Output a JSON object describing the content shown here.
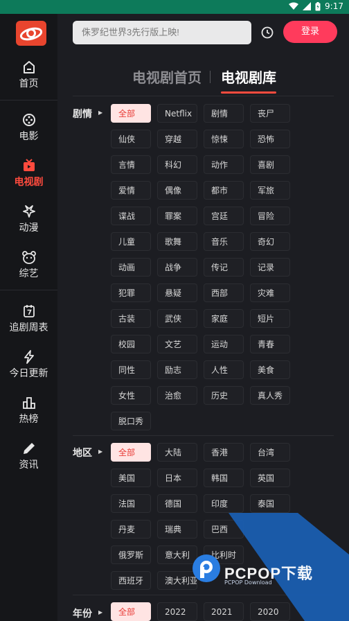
{
  "status_bar": {
    "time": "9:17"
  },
  "sidebar": {
    "items": [
      {
        "label": "首页",
        "icon": "home-icon"
      },
      {
        "label": "电影",
        "icon": "film-reel-icon"
      },
      {
        "label": "电视剧",
        "icon": "tv-icon",
        "active": true
      },
      {
        "label": "动漫",
        "icon": "star-outline-icon"
      },
      {
        "label": "综艺",
        "icon": "bear-face-icon"
      },
      {
        "label": "追剧周表",
        "icon": "calendar-7-icon"
      },
      {
        "label": "今日更新",
        "icon": "lightning-icon"
      },
      {
        "label": "热榜",
        "icon": "bar-chart-icon"
      },
      {
        "label": "资讯",
        "icon": "pencil-icon"
      }
    ]
  },
  "header": {
    "search_placeholder": "侏罗纪世界3先行版上映!",
    "login_label": "登录"
  },
  "tabs": [
    {
      "label": "电视剧首页",
      "active": false
    },
    {
      "label": "电视剧库",
      "active": true
    }
  ],
  "filters": {
    "genre": {
      "label": "剧情",
      "options": [
        "全部",
        "Netflix",
        "剧情",
        "丧尸",
        "仙侠",
        "穿越",
        "惊悚",
        "恐怖",
        "言情",
        "科幻",
        "动作",
        "喜剧",
        "爱情",
        "偶像",
        "都市",
        "军旅",
        "谍战",
        "罪案",
        "宫廷",
        "冒险",
        "儿童",
        "歌舞",
        "音乐",
        "奇幻",
        "动画",
        "战争",
        "传记",
        "记录",
        "犯罪",
        "悬疑",
        "西部",
        "灾难",
        "古装",
        "武侠",
        "家庭",
        "短片",
        "校园",
        "文艺",
        "运动",
        "青春",
        "同性",
        "励志",
        "人性",
        "美食",
        "女性",
        "治愈",
        "历史",
        "真人秀",
        "脱口秀"
      ]
    },
    "region": {
      "label": "地区",
      "options": [
        "全部",
        "大陆",
        "香港",
        "台湾",
        "美国",
        "日本",
        "韩国",
        "英国",
        "法国",
        "德国",
        "印度",
        "泰国",
        "丹麦",
        "瑞典",
        "巴西",
        "",
        "俄罗斯",
        "意大利",
        "比利时",
        "",
        "西班牙",
        "澳大利亚"
      ]
    },
    "year": {
      "label": "年份",
      "options": [
        "全部",
        "2022",
        "2021",
        "2020"
      ]
    }
  },
  "watermark": {
    "text": "PCPOP下载",
    "sub": "PCPOP Download"
  },
  "colors": {
    "accent": "#ff4b3e",
    "login": "#ff3b5c",
    "status_bar": "#0d7a5a",
    "chip_selected_bg": "#ffe4e3"
  }
}
